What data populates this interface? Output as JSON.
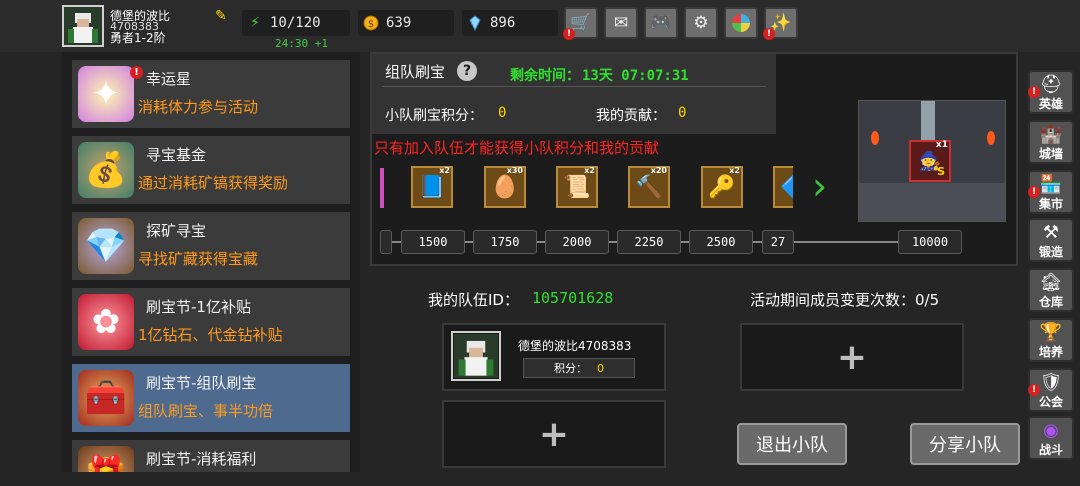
{
  "player": {
    "name": "德堡的波比",
    "id": "4708383",
    "rank": "勇者1-2阶"
  },
  "stats": {
    "stamina": "10/120",
    "gold": "639",
    "diamonds": "896",
    "stamina_timer": "24:30 +1"
  },
  "toolbar": {
    "buttons": [
      "shop-cart-icon",
      "mail-icon",
      "gamepad-icon",
      "gear-icon",
      "color-wheel-icon",
      "fireworks-icon"
    ]
  },
  "menu": {
    "items": [
      {
        "title": "幸运星",
        "desc": "消耗体力参与活动",
        "icon": "lucky-star-icon"
      },
      {
        "title": "寻宝基金",
        "desc": "通过消耗矿镐获得奖励",
        "icon": "treasure-bag-icon"
      },
      {
        "title": "探矿寻宝",
        "desc": "寻找矿藏获得宝藏",
        "icon": "treasure-chest-icon"
      },
      {
        "title": "刷宝节-1亿补贴",
        "desc": "1亿钻石、代金钻补贴",
        "icon": "red-flower-icon"
      },
      {
        "title": "刷宝节-组队刷宝",
        "desc": "组队刷宝、事半功倍",
        "icon": "red-chest-icon"
      },
      {
        "title": "刷宝节-消耗福利",
        "desc": "",
        "icon": "chest-icon"
      }
    ]
  },
  "event": {
    "title": "组队刷宝",
    "remaining_label": "剩余时间：",
    "remaining_value": "13天 07:07:31",
    "team_score_label": "小队刷宝积分：",
    "team_score_value": "0",
    "my_contrib_label": "我的贡献：",
    "my_contrib_value": "0",
    "warning": "只有加入队伍才能获得小队积分和我的贡献"
  },
  "rewards": [
    {
      "icon": "blue-book-icon",
      "count": "x2"
    },
    {
      "icon": "golden-egg-icon",
      "count": "x30"
    },
    {
      "icon": "scroll-icon",
      "count": "x2"
    },
    {
      "icon": "mace-icon",
      "count": "x20"
    },
    {
      "icon": "scepter-icon",
      "count": "x2"
    },
    {
      "icon": "blue-item-icon",
      "count": ""
    }
  ],
  "milestones": [
    "1500",
    "1750",
    "2000",
    "2250",
    "2500",
    "27",
    "10000"
  ],
  "big_reward": {
    "count": "x1",
    "tag": "S"
  },
  "team": {
    "id_label": "我的队伍ID：",
    "id_value": "105701628",
    "changes_label": "活动期间成员变更次数：0/5",
    "member_name": "德堡的波比4708383",
    "member_score_label": "积分：",
    "member_score_value": "0",
    "leave_button": "退出小队",
    "share_button": "分享小队"
  },
  "sidebar": {
    "items": [
      {
        "label": "英雄",
        "icon": "helmet-icon",
        "badge": true
      },
      {
        "label": "城墙",
        "icon": "wall-icon",
        "badge": false
      },
      {
        "label": "集市",
        "icon": "market-icon",
        "badge": true
      },
      {
        "label": "锻造",
        "icon": "anvil-icon",
        "badge": false
      },
      {
        "label": "仓库",
        "icon": "warehouse-icon",
        "badge": false
      },
      {
        "label": "培养",
        "icon": "trophy-icon",
        "badge": false
      },
      {
        "label": "公会",
        "icon": "guild-icon",
        "badge": true
      },
      {
        "label": "战斗",
        "icon": "portal-icon",
        "badge": false
      }
    ]
  }
}
